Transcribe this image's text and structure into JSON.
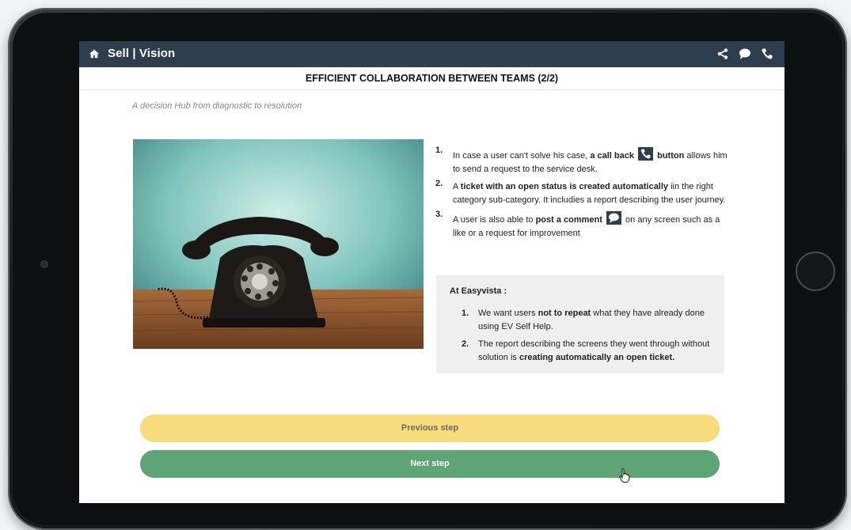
{
  "app": {
    "brand": "Sell | Vision"
  },
  "page": {
    "title": "EFFICIENT COLLABORATION BETWEEN TEAMS (2/2)",
    "subtitle": "A decision Hub from diagnostic to resolution"
  },
  "steps": [
    {
      "num": "1.",
      "parts": [
        "In case a user can't solve his case, ",
        "a  call back",
        "button",
        " allows him to send a request to the service desk."
      ]
    },
    {
      "num": "2.",
      "parts": [
        "A ",
        "ticket with an open status is created automatically",
        " iin the right category sub-category. It includies a report describing the user journey."
      ]
    },
    {
      "num": "3.",
      "parts": [
        "A user is also able to ",
        "post a comment",
        " on any screen such as a like or a request for improvement"
      ]
    }
  ],
  "callout": {
    "heading": "At Easyvista :",
    "items": [
      {
        "num": "1.",
        "parts": [
          "We want users ",
          "not to repeat",
          " what they have already done using EV Self Help."
        ]
      },
      {
        "num": "2.",
        "parts": [
          "The report describing the screens they went through without solution is  ",
          "creating automatically an open ticket."
        ]
      }
    ]
  },
  "buttons": {
    "previous": "Previous step",
    "next": "Next step"
  },
  "icons": {
    "home": "home-icon",
    "share": "share-icon",
    "chat": "chat-icon",
    "phone": "phone-icon"
  },
  "colors": {
    "topbar": "#2f3e4f",
    "previous": "#f7dc7d",
    "next": "#5ea474"
  }
}
